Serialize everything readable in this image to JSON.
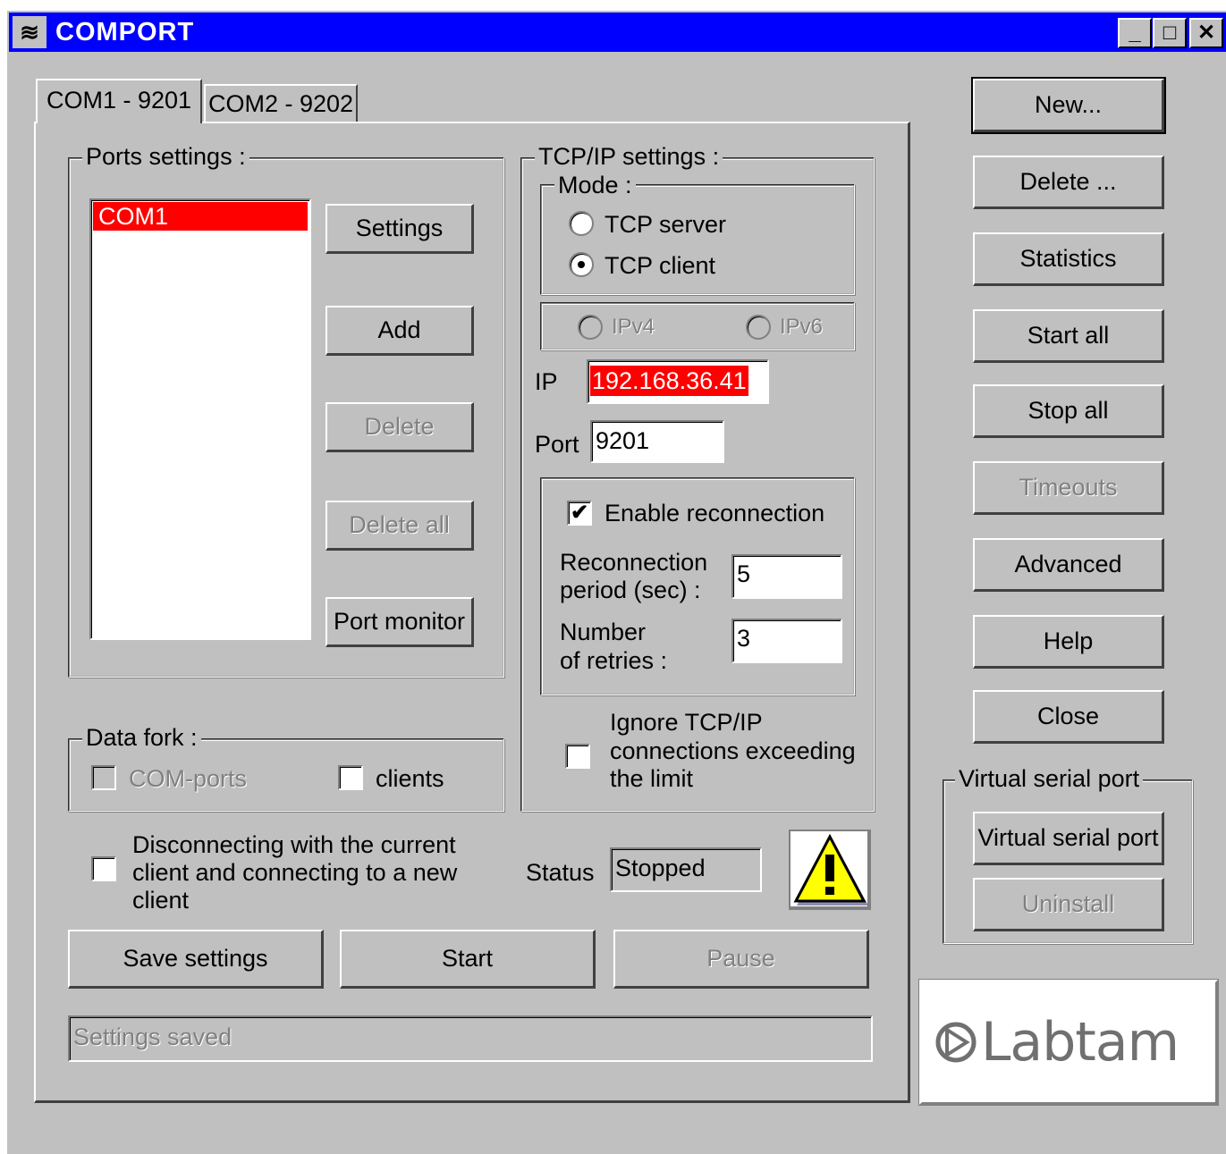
{
  "window": {
    "title": "COMPORT",
    "minimize_glyph": "_",
    "maximize_glyph": "□",
    "close_glyph": "✕"
  },
  "tabs": [
    {
      "label": "COM1 - 9201"
    },
    {
      "label": "COM2 - 9202"
    }
  ],
  "ports_settings": {
    "label": "Ports settings :",
    "ports": [
      "COM1"
    ],
    "selected": "COM1",
    "buttons": {
      "settings": "Settings",
      "add": "Add",
      "delete": "Delete",
      "delete_all": "Delete all",
      "port_monitor": "Port monitor"
    }
  },
  "tcpip": {
    "label": "TCP/IP settings :",
    "mode_label": "Mode :",
    "tcp_server": "TCP server",
    "tcp_client": "TCP client",
    "ipv4": "IPv4",
    "ipv6": "IPv6",
    "ip_label": "IP",
    "ip_value": "192.168.36.41",
    "port_label": "Port",
    "port_value": "9201",
    "enable_reconnection": "Enable reconnection",
    "reconnection_period_line1": "Reconnection",
    "reconnection_period_line2": "period (sec) :",
    "reconnection_period_value": "5",
    "retries_line1": "Number",
    "retries_line2": "of retries :",
    "retries_value": "3",
    "ignore_line1": "Ignore TCP/IP",
    "ignore_line2": "connections exceeding",
    "ignore_line3": "the limit"
  },
  "data_fork": {
    "label": "Data fork :",
    "com_ports": "COM-ports",
    "clients": "clients"
  },
  "disconnect": {
    "line1": "Disconnecting with the current",
    "line2": "client and connecting to a new",
    "line3": "client"
  },
  "status": {
    "label": "Status",
    "value": "Stopped"
  },
  "bottom_buttons": {
    "save": "Save settings",
    "start": "Start",
    "pause": "Pause"
  },
  "status_bar": {
    "text": "Settings saved"
  },
  "side_buttons": {
    "new": "New...",
    "delete": "Delete ...",
    "statistics": "Statistics",
    "start_all": "Start all",
    "stop_all": "Stop all",
    "timeouts": "Timeouts",
    "advanced": "Advanced",
    "help": "Help",
    "close": "Close"
  },
  "virtual_serial_port": {
    "label": "Virtual serial port",
    "button": "Virtual serial port",
    "uninstall": "Uninstall"
  },
  "logo": {
    "text": "Labtam"
  },
  "colors": {
    "title_bar": "#0000ff",
    "selection": "#ff0000",
    "face": "#c0c0c0"
  }
}
